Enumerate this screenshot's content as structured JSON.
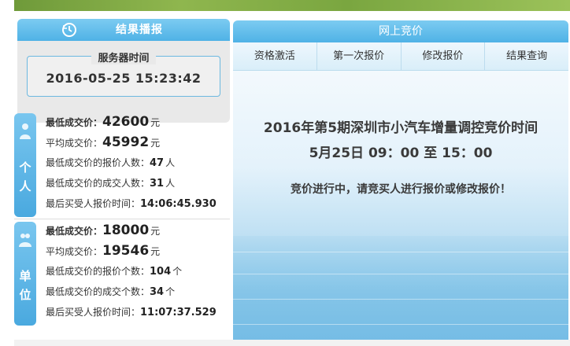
{
  "left": {
    "header_title": "结果播报",
    "server": {
      "label": "服务器时间",
      "time": "2016-05-25 15:23:42"
    },
    "personal": {
      "tab": [
        "个",
        "人"
      ],
      "rows": [
        {
          "label": "最低成交价：",
          "value": "42600",
          "unit": "元"
        },
        {
          "label": "平均成交价：",
          "value": "45992",
          "unit": "元"
        },
        {
          "label": "最低成交价的报价人数：",
          "value": "47",
          "unit": "人"
        },
        {
          "label": "最低成交价的成交人数：",
          "value": "31",
          "unit": "人"
        },
        {
          "label": "最后买受人报价时间：",
          "value": "14:06:45.930",
          "unit": ""
        }
      ]
    },
    "unit": {
      "tab": [
        "单",
        "位"
      ],
      "rows": [
        {
          "label": "最低成交价：",
          "value": "18000",
          "unit": "元"
        },
        {
          "label": "平均成交价：",
          "value": "19546",
          "unit": "元"
        },
        {
          "label": "最低成交价的报价个数：",
          "value": "104",
          "unit": "个"
        },
        {
          "label": "最低成交价的成交个数：",
          "value": "34",
          "unit": "个"
        },
        {
          "label": "最后买受人报价时间：",
          "value": "11:07:37.529",
          "unit": ""
        }
      ]
    }
  },
  "right": {
    "header_title": "网上竞价",
    "tabs": [
      "资格激活",
      "第一次报价",
      "修改报价",
      "结果查询"
    ],
    "headline": "2016年第5期深圳市小汽车增量调控竞价时间",
    "time_range": "5月25日 09：00 至 15：00",
    "status": "竞价进行中，请竞买人进行报价或修改报价！"
  },
  "colors": {
    "accent": "#4fb2e6",
    "header_text": "#ffffff"
  },
  "icons": {
    "header": "refresh-clock-icon",
    "personal": "person-icon",
    "unit": "group-icon"
  }
}
